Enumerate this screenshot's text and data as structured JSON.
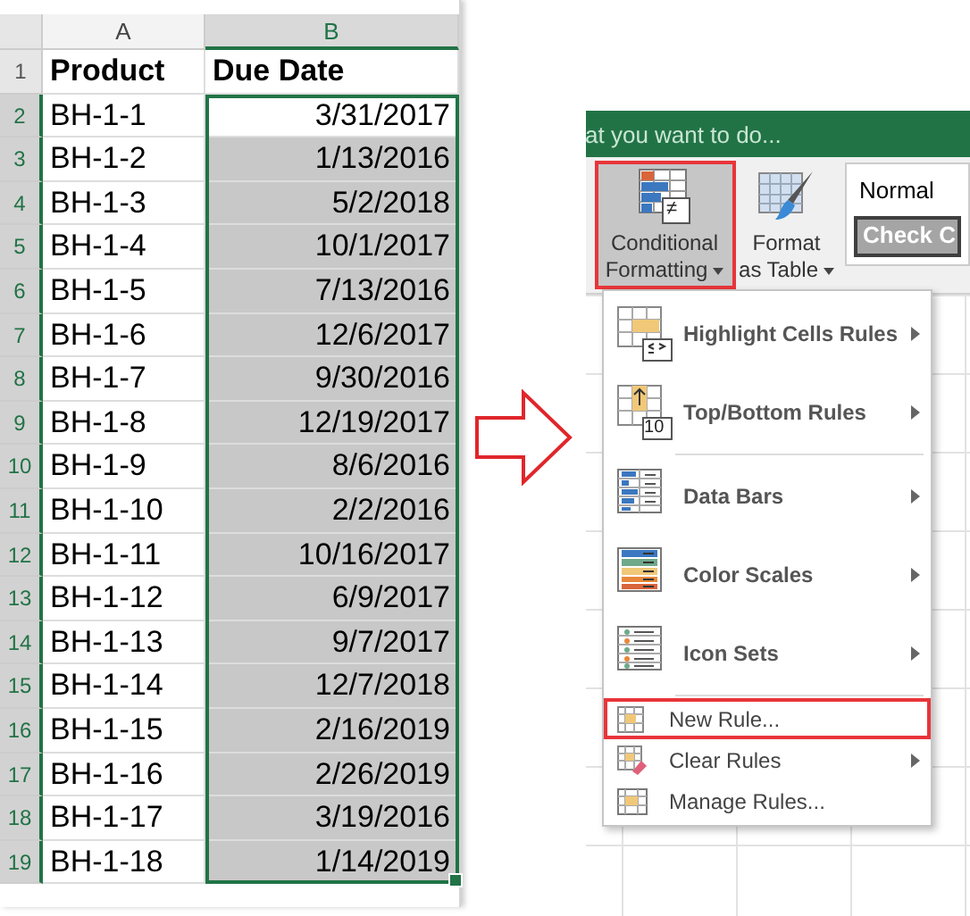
{
  "sheet": {
    "columns": [
      {
        "label": "A",
        "selected": false
      },
      {
        "label": "B",
        "selected": true
      }
    ],
    "rows": [
      {
        "number": "1",
        "kind": "header",
        "selected": false,
        "highlighted": false,
        "cells": [
          "Product",
          "Due Date"
        ]
      },
      {
        "number": "2",
        "kind": "data",
        "selected": true,
        "highlighted": false,
        "cells": [
          "BH-1-1",
          "3/31/2017"
        ]
      },
      {
        "number": "3",
        "kind": "data",
        "selected": true,
        "highlighted": true,
        "cells": [
          "BH-1-2",
          "1/13/2016"
        ]
      },
      {
        "number": "4",
        "kind": "data",
        "selected": true,
        "highlighted": true,
        "cells": [
          "BH-1-3",
          "5/2/2018"
        ]
      },
      {
        "number": "5",
        "kind": "data",
        "selected": true,
        "highlighted": true,
        "cells": [
          "BH-1-4",
          "10/1/2017"
        ]
      },
      {
        "number": "6",
        "kind": "data",
        "selected": true,
        "highlighted": true,
        "cells": [
          "BH-1-5",
          "7/13/2016"
        ]
      },
      {
        "number": "7",
        "kind": "data",
        "selected": true,
        "highlighted": true,
        "cells": [
          "BH-1-6",
          "12/6/2017"
        ]
      },
      {
        "number": "8",
        "kind": "data",
        "selected": true,
        "highlighted": true,
        "cells": [
          "BH-1-7",
          "9/30/2016"
        ]
      },
      {
        "number": "9",
        "kind": "data",
        "selected": true,
        "highlighted": true,
        "cells": [
          "BH-1-8",
          "12/19/2017"
        ]
      },
      {
        "number": "10",
        "kind": "data",
        "selected": true,
        "highlighted": true,
        "cells": [
          "BH-1-9",
          "8/6/2016"
        ]
      },
      {
        "number": "11",
        "kind": "data",
        "selected": true,
        "highlighted": true,
        "cells": [
          "BH-1-10",
          "2/2/2016"
        ]
      },
      {
        "number": "12",
        "kind": "data",
        "selected": true,
        "highlighted": true,
        "cells": [
          "BH-1-11",
          "10/16/2017"
        ]
      },
      {
        "number": "13",
        "kind": "data",
        "selected": true,
        "highlighted": true,
        "cells": [
          "BH-1-12",
          "6/9/2017"
        ]
      },
      {
        "number": "14",
        "kind": "data",
        "selected": true,
        "highlighted": true,
        "cells": [
          "BH-1-13",
          "9/7/2017"
        ]
      },
      {
        "number": "15",
        "kind": "data",
        "selected": true,
        "highlighted": true,
        "cells": [
          "BH-1-14",
          "12/7/2018"
        ]
      },
      {
        "number": "16",
        "kind": "data",
        "selected": true,
        "highlighted": true,
        "cells": [
          "BH-1-15",
          "2/16/2019"
        ]
      },
      {
        "number": "17",
        "kind": "data",
        "selected": true,
        "highlighted": true,
        "cells": [
          "BH-1-16",
          "2/26/2019"
        ]
      },
      {
        "number": "18",
        "kind": "data",
        "selected": true,
        "highlighted": true,
        "cells": [
          "BH-1-17",
          "3/19/2016"
        ]
      },
      {
        "number": "19",
        "kind": "data",
        "selected": true,
        "highlighted": true,
        "cells": [
          "BH-1-18",
          "1/14/2019"
        ]
      }
    ]
  },
  "ribbon": {
    "search_text": "at you want to do...",
    "buttons": [
      {
        "label": "Conditional Formatting",
        "icon_badge": "≠",
        "selected": true
      },
      {
        "label": "Format as Table",
        "selected": false
      }
    ],
    "styles": [
      {
        "label": "Normal",
        "kind": "normal"
      },
      {
        "label": "Check C",
        "kind": "check"
      }
    ]
  },
  "menu": {
    "sections": [
      {
        "kind": "large",
        "items": [
          {
            "label": "Highlight Cells Rules",
            "submenu": true,
            "highlighted": false
          },
          {
            "label": "Top/Bottom Rules",
            "icon_badge": "10",
            "submenu": true,
            "highlighted": false
          }
        ]
      },
      {
        "kind": "large",
        "items": [
          {
            "label": "Data Bars",
            "submenu": true,
            "highlighted": false
          },
          {
            "label": "Color Scales",
            "submenu": true,
            "highlighted": false
          },
          {
            "label": "Icon Sets",
            "submenu": true,
            "highlighted": false
          }
        ]
      },
      {
        "kind": "small",
        "items": [
          {
            "label": "New Rule...",
            "submenu": false,
            "highlighted": true
          },
          {
            "label": "Clear Rules",
            "submenu": true,
            "highlighted": false
          },
          {
            "label": "Manage Rules...",
            "submenu": false,
            "highlighted": false
          }
        ]
      }
    ]
  }
}
